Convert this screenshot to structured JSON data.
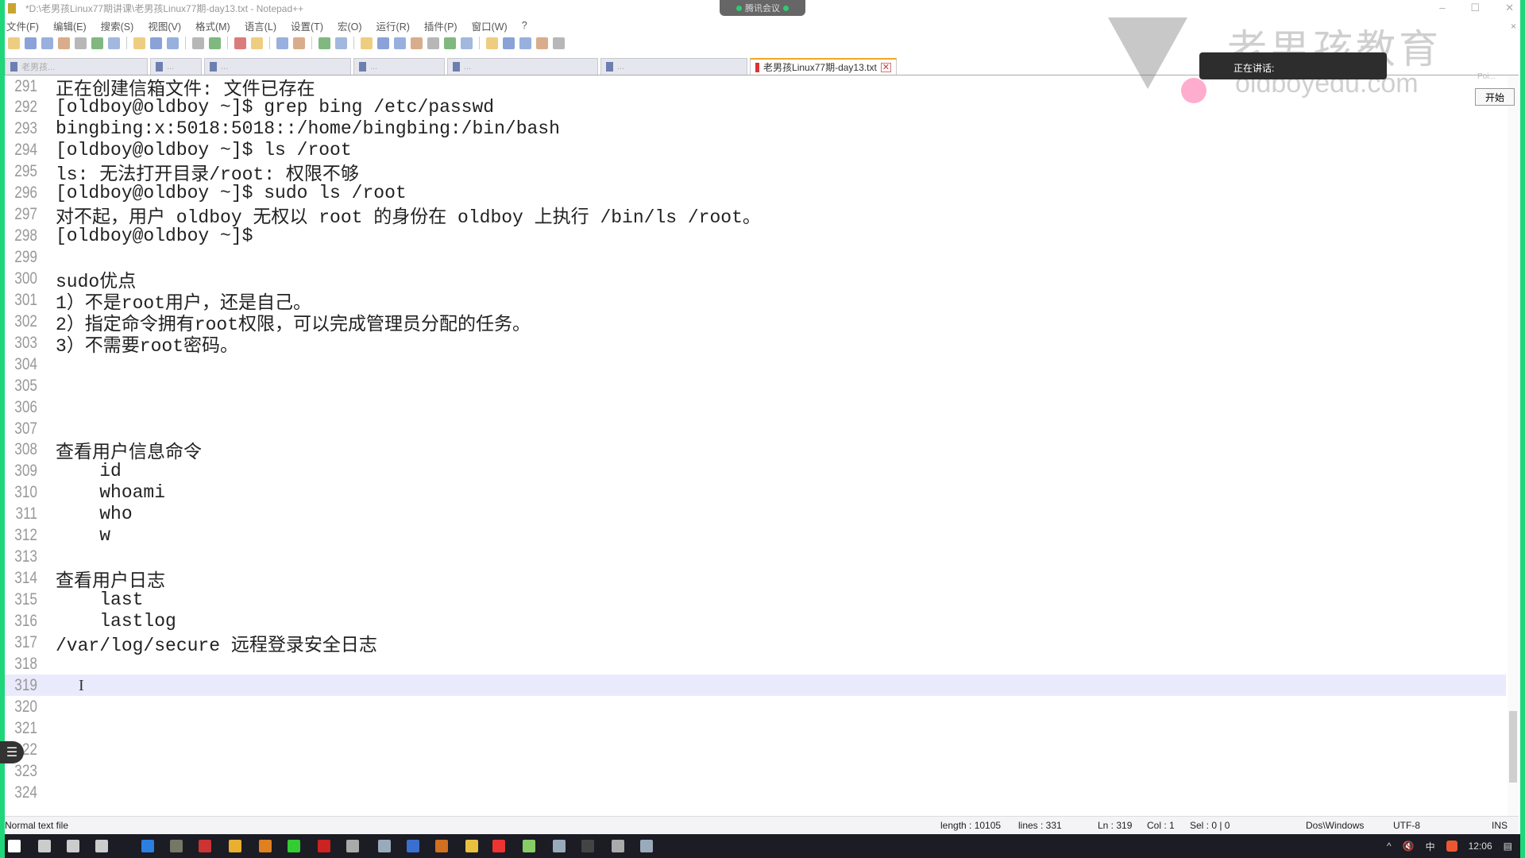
{
  "window": {
    "title": "*D:\\老男孩Linux77期讲课\\老男孩Linux77期-day13.txt - Notepad++",
    "minimize": "–",
    "maximize": "☐",
    "close": "✕"
  },
  "meeting": {
    "label": "腾讯会议"
  },
  "menu": [
    "文件(F)",
    "编辑(E)",
    "搜索(S)",
    "视图(V)",
    "格式(M)",
    "语言(L)",
    "设置(T)",
    "宏(O)",
    "运行(R)",
    "插件(P)",
    "窗口(W)",
    "?"
  ],
  "toolbar_icons": [
    "new-icon",
    "open-icon",
    "save-icon",
    "save-all-icon",
    "close-icon",
    "close-all-icon",
    "print-icon",
    "|",
    "cut-icon",
    "copy-icon",
    "paste-icon",
    "|",
    "undo-icon",
    "redo-icon",
    "|",
    "find-icon",
    "replace-icon",
    "|",
    "zoom-in-icon",
    "zoom-out-icon",
    "|",
    "sync-v-icon",
    "sync-h-icon",
    "|",
    "wrap-icon",
    "all-chars-icon",
    "indent-guide-icon",
    "doc-map-icon",
    "function-list-icon",
    "folder-workspace-icon",
    "monitor-icon",
    "|",
    "record-macro-icon",
    "stop-macro-icon",
    "play-macro-icon",
    "run-macro-multiple-icon",
    "save-macro-icon"
  ],
  "tabs": [
    {
      "label": "老男孩...",
      "active": false
    },
    {
      "label": "...",
      "active": false
    },
    {
      "label": "...",
      "active": false
    },
    {
      "label": "...",
      "active": false
    },
    {
      "label": "...",
      "active": false
    },
    {
      "label": "...",
      "active": false
    },
    {
      "label": "老男孩Linux77期-day13.txt",
      "active": true
    }
  ],
  "editor": {
    "current_line": 319,
    "lines": [
      {
        "n": 291,
        "t": "正在创建信箱文件: 文件已存在"
      },
      {
        "n": 292,
        "t": "[oldboy@oldboy ~]$ grep bing /etc/passwd"
      },
      {
        "n": 293,
        "t": "bingbing:x:5018:5018::/home/bingbing:/bin/bash"
      },
      {
        "n": 294,
        "t": "[oldboy@oldboy ~]$ ls /root"
      },
      {
        "n": 295,
        "t": "ls: 无法打开目录/root: 权限不够"
      },
      {
        "n": 296,
        "t": "[oldboy@oldboy ~]$ sudo ls /root"
      },
      {
        "n": 297,
        "t": "对不起，用户 oldboy 无权以 root 的身份在 oldboy 上执行 /bin/ls /root。"
      },
      {
        "n": 298,
        "t": "[oldboy@oldboy ~]$"
      },
      {
        "n": 299,
        "t": ""
      },
      {
        "n": 300,
        "t": "sudo优点"
      },
      {
        "n": 301,
        "t": "1）不是root用户，还是自己。"
      },
      {
        "n": 302,
        "t": "2）指定命令拥有root权限，可以完成管理员分配的任务。"
      },
      {
        "n": 303,
        "t": "3）不需要root密码。"
      },
      {
        "n": 304,
        "t": ""
      },
      {
        "n": 305,
        "t": ""
      },
      {
        "n": 306,
        "t": ""
      },
      {
        "n": 307,
        "t": ""
      },
      {
        "n": 308,
        "t": "查看用户信息命令"
      },
      {
        "n": 309,
        "t": "    id"
      },
      {
        "n": 310,
        "t": "    whoami"
      },
      {
        "n": 311,
        "t": "    who"
      },
      {
        "n": 312,
        "t": "    w"
      },
      {
        "n": 313,
        "t": ""
      },
      {
        "n": 314,
        "t": "查看用户日志"
      },
      {
        "n": 315,
        "t": "    last"
      },
      {
        "n": 316,
        "t": "    lastlog"
      },
      {
        "n": 317,
        "t": "/var/log/secure 远程登录安全日志"
      },
      {
        "n": 318,
        "t": ""
      },
      {
        "n": 319,
        "t": ""
      },
      {
        "n": 320,
        "t": ""
      },
      {
        "n": 321,
        "t": ""
      },
      {
        "n": 322,
        "t": ""
      },
      {
        "n": 323,
        "t": ""
      },
      {
        "n": 324,
        "t": ""
      }
    ]
  },
  "overlay": {
    "watermark_title": "老男孩教育",
    "watermark_url": "oldboyedu.com",
    "talking_label": "正在讲话:",
    "start_button": "开始",
    "poi": "Poi...",
    "close": "×"
  },
  "status": {
    "file_type": "Normal text file",
    "length": "length : 10105",
    "lines": "lines : 331",
    "ln": "Ln : 319",
    "col": "Col : 1",
    "sel": "Sel : 0 | 0",
    "eol": "Dos\\Windows",
    "encoding": "UTF-8",
    "mode": "INS"
  },
  "taskbar": {
    "clock": "12:06",
    "ime": "中"
  },
  "colors": {
    "accent_green": "#1fd67a",
    "current_line": "#e9eafc",
    "active_tab_border": "#f5a623"
  }
}
